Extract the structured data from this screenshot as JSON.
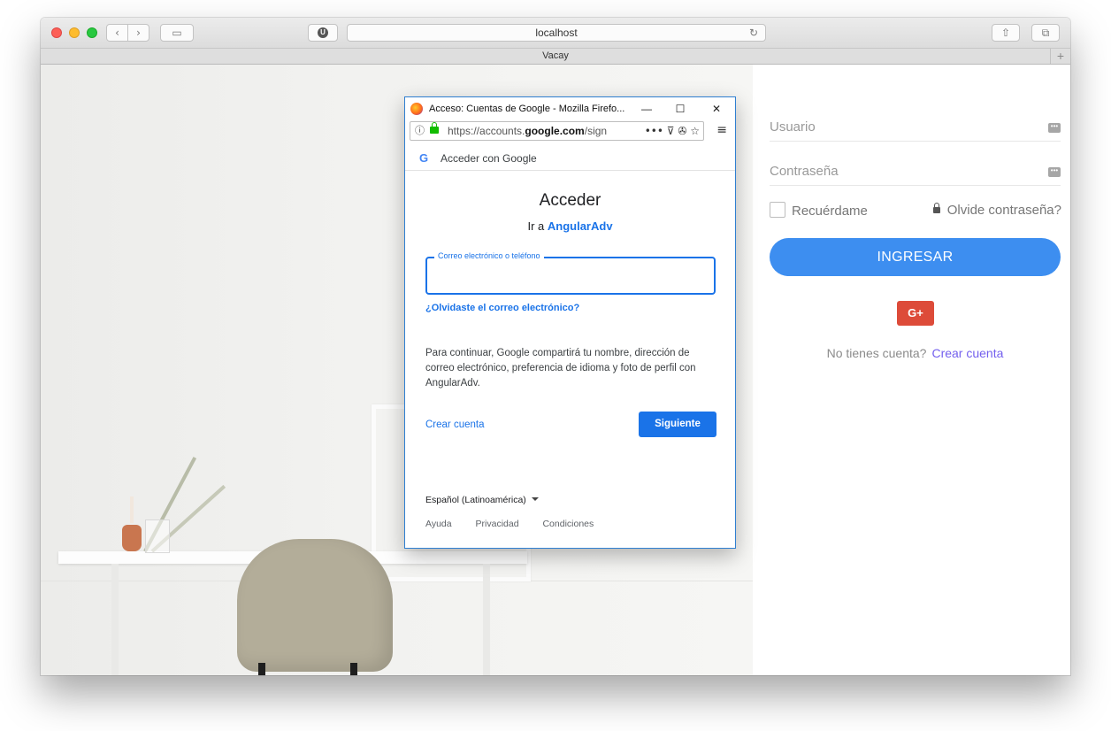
{
  "browser": {
    "url": "localhost",
    "tab_title": "Vacay",
    "new_tab": "+",
    "back_icon": "chevron-left-icon",
    "forward_icon": "chevron-right-icon",
    "extension_badge": "U"
  },
  "login": {
    "username_placeholder": "Usuario",
    "password_placeholder": "Contraseña",
    "remember_label": "Recuérdame",
    "forgot_label": "Olvide contraseña?",
    "submit_label": "INGRESAR",
    "google_label": "G+",
    "no_account_text": "No tienes cuenta?",
    "create_account_link": "Crear cuenta",
    "colors": {
      "primary": "#3d8ef0",
      "google": "#dd4b39",
      "link": "#7460ee"
    }
  },
  "popup": {
    "window_title": "Acceso: Cuentas de Google - Mozilla Firefo...",
    "url_prefix": "https://accounts.",
    "url_domain": "google.com",
    "url_suffix": "/sign",
    "header_text": "Acceder con Google",
    "title": "Acceder",
    "subtitle_prefix": "Ir a",
    "app_name": "AngularAdv",
    "email_label": "Correo electrónico o teléfono",
    "forgot_email": "¿Olvidaste el correo electrónico?",
    "consent_text": "Para continuar, Google compartirá tu nombre, dirección de correo electrónico, preferencia de idioma y foto de perfil con AngularAdv.",
    "create_account": "Crear cuenta",
    "next_button": "Siguiente",
    "language": "Español (Latinoamérica)",
    "footer_links": [
      "Ayuda",
      "Privacidad",
      "Condiciones"
    ],
    "colors": {
      "blue": "#1a73e8",
      "border": "#2f7fd1"
    }
  }
}
